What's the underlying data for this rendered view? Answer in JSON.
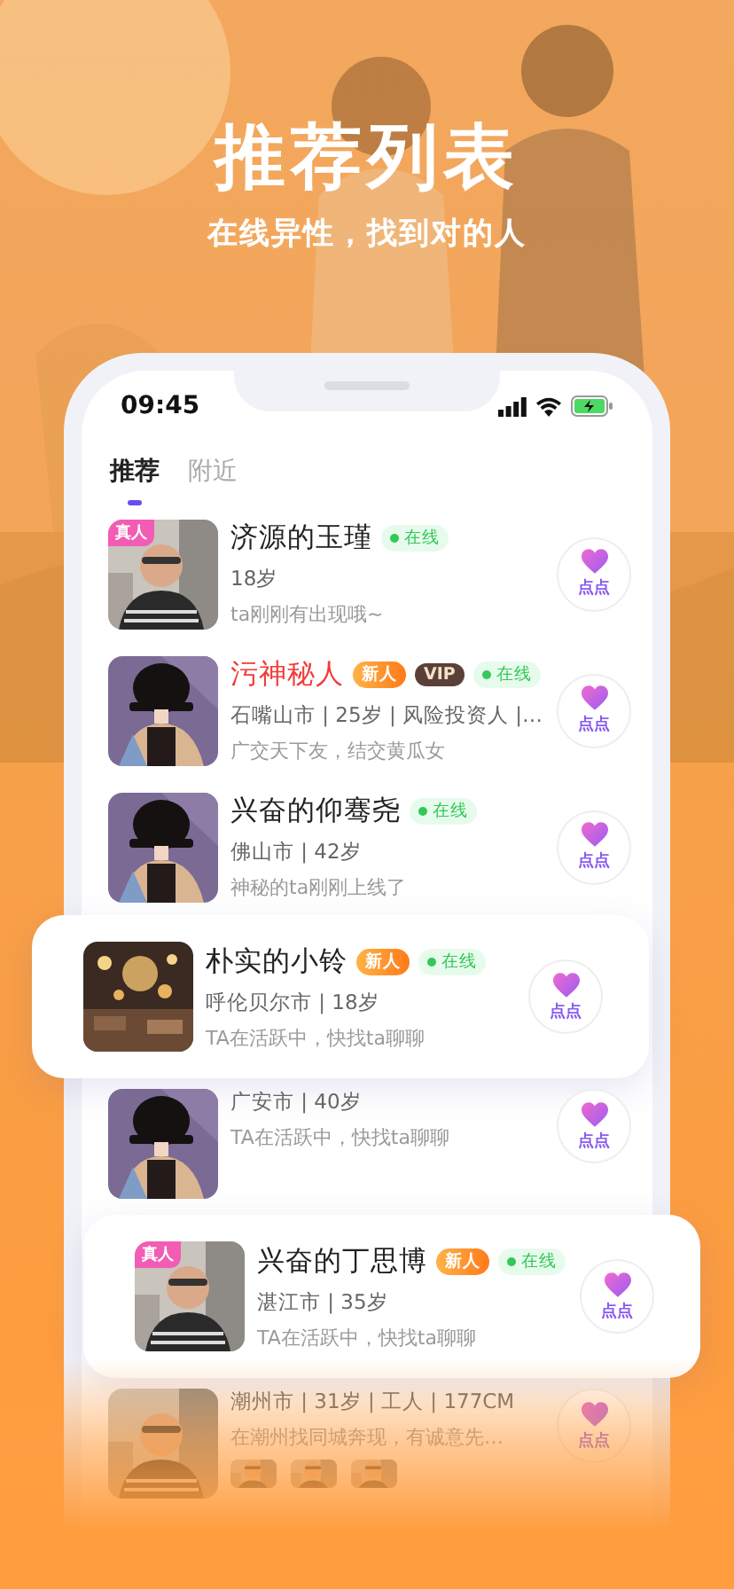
{
  "header": {
    "title": "推荐列表",
    "subtitle": "在线异性，找到对的人"
  },
  "status_bar": {
    "time": "09:45"
  },
  "tabs": [
    {
      "label": "推荐",
      "selected": true
    },
    {
      "label": "附近",
      "selected": false
    }
  ],
  "list": [
    {
      "kind": "row",
      "avatar": {
        "kind": "picture"
      },
      "verified_tag": "真人",
      "name": "济源的玉瑾",
      "highlighted": false,
      "online": "在线",
      "info": "18岁",
      "status": "ta刚刚有出现哦~",
      "like": "点点"
    },
    {
      "kind": "row",
      "avatar": {
        "kind": "picture"
      },
      "name": "污神秘人",
      "highlighted": true,
      "badges": [
        {
          "kind": "new",
          "text": "新人"
        },
        {
          "kind": "vip",
          "text": "VIP"
        }
      ],
      "online": "在线",
      "info": "石嘴山市 | 25岁 | 风险投资人 |…",
      "status": "广交天下友，结交黄瓜女",
      "like": "点点"
    },
    {
      "kind": "row",
      "avatar": {
        "kind": "picture"
      },
      "name": "兴奋的仰骞尧",
      "highlighted": false,
      "online": "在线",
      "info": "佛山市 | 42岁",
      "status": "神秘的ta刚刚上线了",
      "like": "点点"
    },
    {
      "kind": "featured",
      "avatar": {
        "kind": "picture"
      },
      "name": "朴实的小铃",
      "highlighted": false,
      "badges": [
        {
          "kind": "new",
          "text": "新人"
        }
      ],
      "online": "在线",
      "info": "呼伦贝尔市 | 18岁",
      "status": "TA在活跃中，快找ta聊聊",
      "like": "点点"
    },
    {
      "kind": "row",
      "avatar": {
        "kind": "picture"
      },
      "info": "广安市 | 40岁",
      "status": "TA在活跃中，快找ta聊聊",
      "like": "点点"
    },
    {
      "kind": "featured",
      "avatar": {
        "kind": "picture"
      },
      "verified_tag": "真人",
      "name": "兴奋的丁思博",
      "highlighted": false,
      "badges": [
        {
          "kind": "new",
          "text": "新人"
        }
      ],
      "online": "在线",
      "info": "湛江市 | 35岁",
      "status": "TA在活跃中，快找ta聊聊",
      "like": "点点"
    },
    {
      "kind": "row",
      "avatar": {
        "kind": "picture"
      },
      "info": "潮州市 | 31岁 | 工人 | 177CM",
      "status": "在潮州找同城奔现，有诚意先…",
      "photos": [
        {
          "kind": "picture"
        },
        {
          "kind": "picture"
        },
        {
          "kind": "picture"
        }
      ],
      "like": "点点"
    }
  ]
}
